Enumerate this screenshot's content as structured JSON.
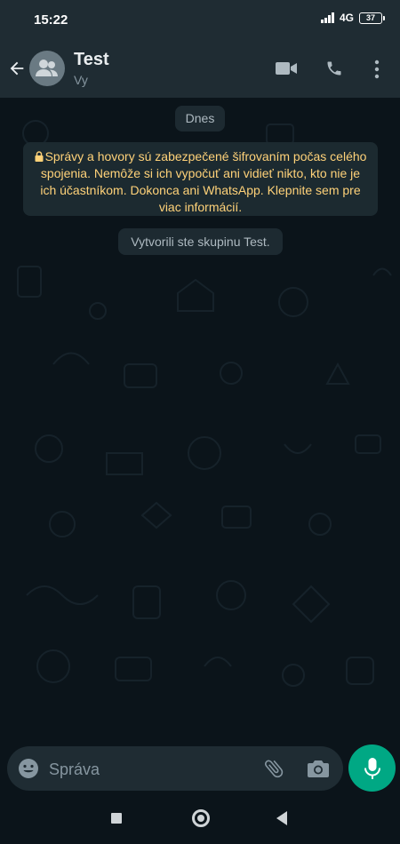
{
  "status_bar": {
    "time": "15:22",
    "network": "4G",
    "battery": "37"
  },
  "header": {
    "title": "Test",
    "subtitle": "Vy",
    "icons": [
      "arrow-left-icon",
      "group-avatar-icon",
      "video-call-icon",
      "phone-call-icon",
      "more-vertical-icon"
    ]
  },
  "chat": {
    "date_label": "Dnes",
    "encryption_notice": "Správy a hovory sú zabezpečené šifrovaním počas celého spojenia. Nemôže si ich vypočuť ani vidieť nikto, kto nie je ich účastníkom. Dokonca ani WhatsApp. Klepnite sem pre viac informácií.",
    "system_message": "Vytvorili ste skupinu Test."
  },
  "composer": {
    "placeholder": "Správa",
    "value": "",
    "icons": [
      "emoji-icon",
      "attach-icon",
      "camera-icon",
      "mic-icon"
    ]
  },
  "colors": {
    "background": "#0b141a",
    "header": "#1f2c33",
    "accent": "#00a884",
    "notice_text": "#ffd279",
    "bubble": "#1d2a31"
  }
}
